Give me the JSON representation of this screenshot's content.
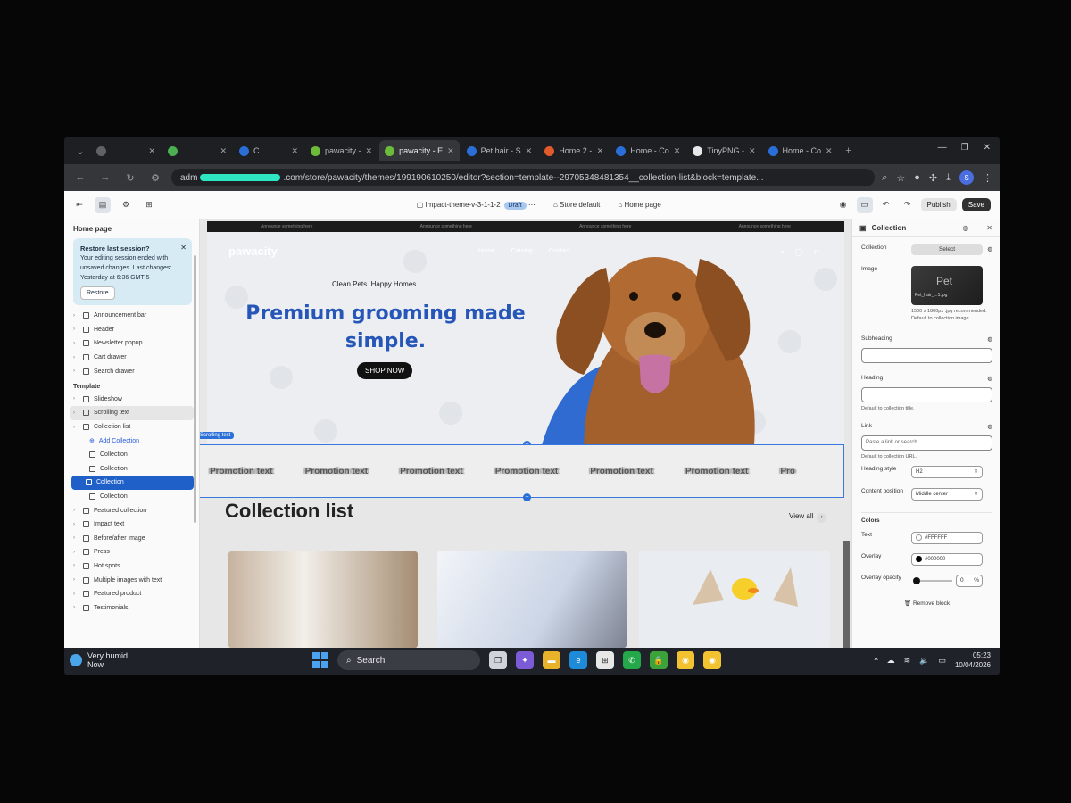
{
  "browser": {
    "tabs": [
      {
        "label": "",
        "color": "#5f6368",
        "active": false
      },
      {
        "label": "",
        "color": "#4caf50",
        "active": false
      },
      {
        "label": "C",
        "color": "#2a6fd8",
        "active": false
      },
      {
        "label": "pawacity - ",
        "color": "#6dbb3a",
        "active": false
      },
      {
        "label": "pawacity - E",
        "color": "#6dbb3a",
        "active": true
      },
      {
        "label": "Pet hair - S",
        "color": "#2a6fd8",
        "active": false
      },
      {
        "label": "Home 2 - ",
        "color": "#e05a2b",
        "active": false
      },
      {
        "label": "Home - Co",
        "color": "#2a6fd8",
        "active": false
      },
      {
        "label": "TinyPNG - ",
        "color": "#e8e8e8",
        "active": false
      },
      {
        "label": "Home - Co",
        "color": "#2a6fd8",
        "active": false
      }
    ],
    "url_prefix": "adm",
    "url_suffix": ".com/store/pawacity/themes/199190610250/editor?section=template--29705348481354__collection-list&block=template...",
    "profile_initial": "S"
  },
  "editor": {
    "theme_name": "Impact-theme-v-3-1-1-2",
    "draft_label": "Draft",
    "store_label": "Store default",
    "page_label": "Home page",
    "publish_label": "Publish",
    "save_label": "Save"
  },
  "sidebar": {
    "title": "Home page",
    "restore": {
      "title": "Restore last session?",
      "body": "Your editing session ended with unsaved changes. Last changes: Yesterday at 6:36 GMT-5",
      "button": "Restore"
    },
    "header_items": [
      "Announcement bar",
      "Header",
      "Newsletter popup",
      "Cart drawer",
      "Search drawer"
    ],
    "template_label": "Template",
    "items": [
      {
        "label": "Slideshow",
        "level": 0,
        "state": ""
      },
      {
        "label": "Scrolling text",
        "level": 0,
        "state": "hl"
      },
      {
        "label": "Collection list",
        "level": 0,
        "state": ""
      },
      {
        "label": "Add Collection",
        "level": 1,
        "state": "add"
      },
      {
        "label": "Collection",
        "level": 1,
        "state": ""
      },
      {
        "label": "Collection",
        "level": 1,
        "state": ""
      },
      {
        "label": "Collection",
        "level": 1,
        "state": "sel"
      },
      {
        "label": "Collection",
        "level": 1,
        "state": ""
      },
      {
        "label": "Featured collection",
        "level": 0,
        "state": ""
      },
      {
        "label": "Impact text",
        "level": 0,
        "state": ""
      },
      {
        "label": "Before/after image",
        "level": 0,
        "state": ""
      },
      {
        "label": "Press",
        "level": 0,
        "state": ""
      },
      {
        "label": "Hot spots",
        "level": 0,
        "state": ""
      },
      {
        "label": "Multiple images with text",
        "level": 0,
        "state": ""
      },
      {
        "label": "Featured product",
        "level": 0,
        "state": ""
      },
      {
        "label": "Testimonials",
        "level": 0,
        "state": ""
      }
    ]
  },
  "preview": {
    "logo": "pawacity",
    "nav": [
      "Home",
      "Catalog",
      "Contact"
    ],
    "announcement": [
      "Announce something here",
      "Announce something here",
      "Announce something here",
      "Announce something here"
    ],
    "tagline": "Clean Pets. Happy Homes.",
    "headline": "Premium grooming made simple.",
    "cta": "SHOP NOW",
    "scrolling_label": "Scrolling text",
    "promos": [
      "Promotion text",
      "Promotion text",
      "Promotion text",
      "Promotion text",
      "Promotion text",
      "Promotion text",
      "Pro"
    ],
    "collection_title": "Collection list",
    "view_all": "View all"
  },
  "panel": {
    "title": "Collection",
    "collection_label": "Collection",
    "select_label": "Select",
    "image_label": "Image",
    "image_thumb_text": "Pet",
    "image_file": "Pet_hair_...1.jpg",
    "image_hint": "1500 x 1800px .jpg recommended. Default to collection image.",
    "subheading_label": "Subheading",
    "heading_label": "Heading",
    "heading_hint": "Default to collection title.",
    "link_label": "Link",
    "link_placeholder": "Paste a link or search",
    "link_hint": "Default to collection URL.",
    "heading_style_label": "Heading style",
    "heading_style_value": "H2",
    "content_position_label": "Content position",
    "content_position_value": "Middle center",
    "colors_label": "Colors",
    "text_label": "Text",
    "text_color": "#FFFFFF",
    "overlay_label": "Overlay",
    "overlay_color": "#000000",
    "overlay_opacity_label": "Overlay opacity",
    "overlay_opacity_value": "0",
    "overlay_opacity_unit": "%",
    "remove_label": "Remove block"
  },
  "taskbar": {
    "weather_line1": "Very humid",
    "weather_line2": "Now",
    "search_label": "Search",
    "time": "05:23",
    "date": "10/04/2026"
  },
  "colors": {
    "accent": "#2556b8",
    "selection": "#1f5fc8"
  }
}
